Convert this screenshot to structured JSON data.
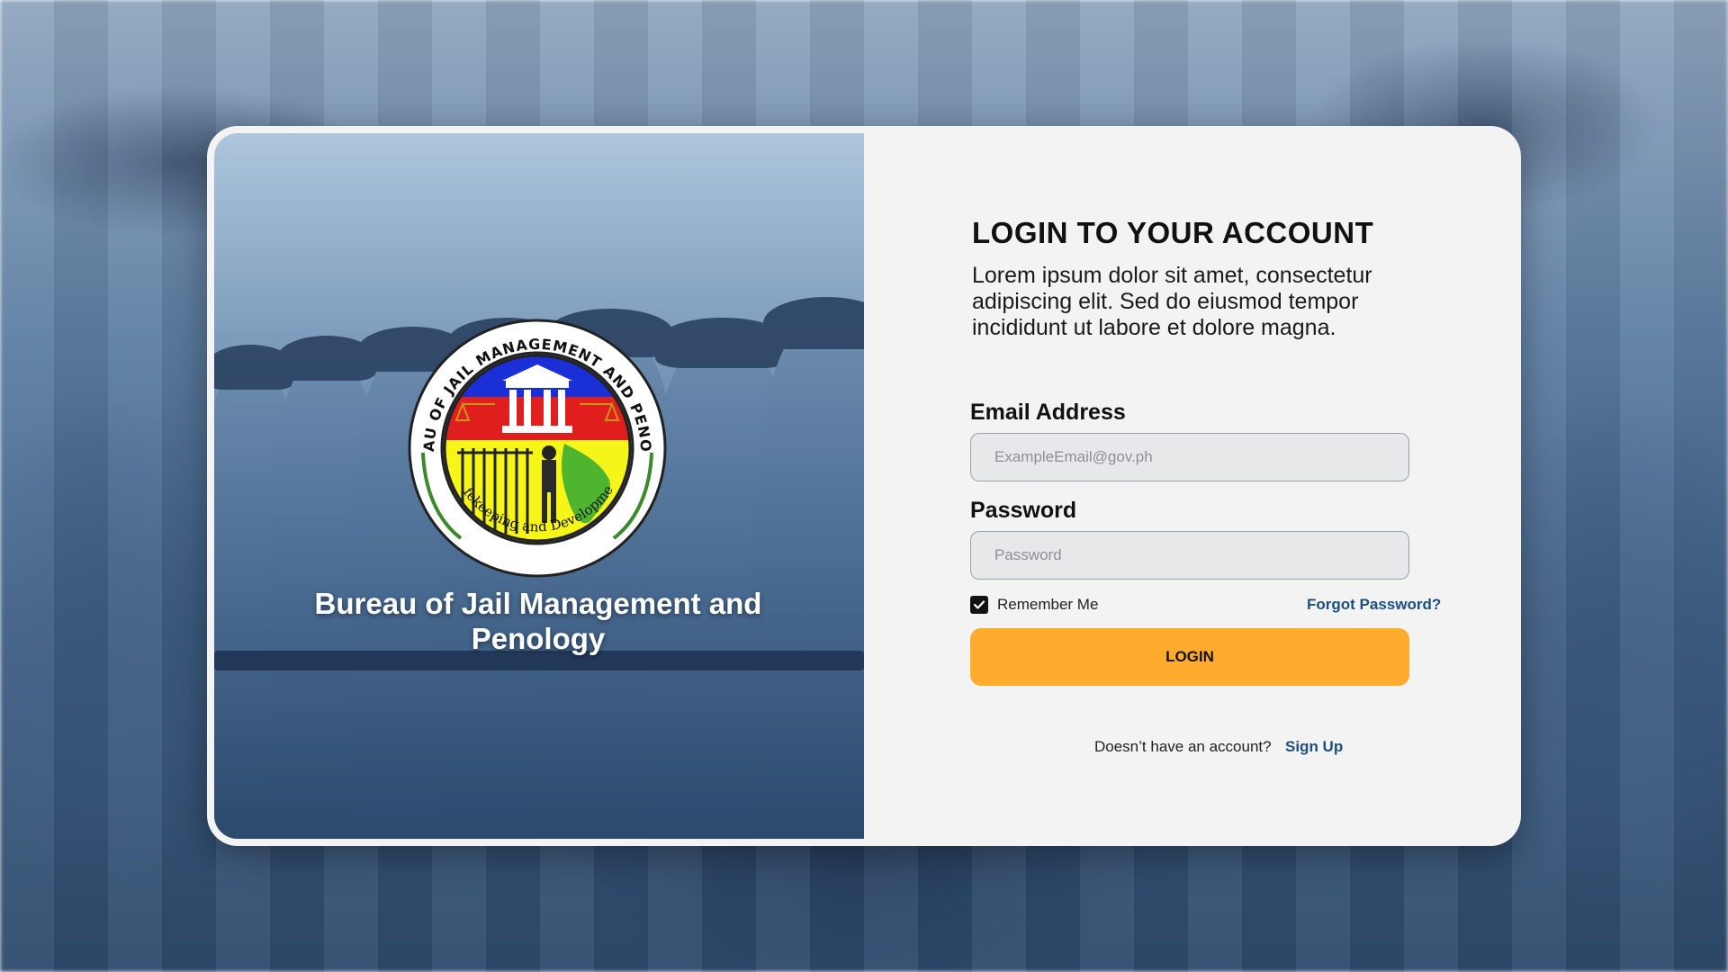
{
  "brand": {
    "agency_name": "Bureau of Jail Management and Penology",
    "seal_top_text": "BUREAU OF JAIL MANAGEMENT AND PENOLOGY",
    "seal_motto": "Safekeeping and Development"
  },
  "login": {
    "title": "LOGIN TO YOUR ACCOUNT",
    "description": "Lorem ipsum dolor sit amet, consectetur adipiscing elit. Sed do eiusmod tempor incididunt ut labore et dolore magna.",
    "email_label": "Email Address",
    "email_placeholder": "ExampleEmail@gov.ph",
    "email_value": "",
    "password_label": "Password",
    "password_placeholder": "Password",
    "password_value": "",
    "remember_label": "Remember Me",
    "remember_checked": true,
    "forgot_label": "Forgot Password?",
    "login_button": "LOGIN",
    "signup_prompt": "Doesn’t have an account?",
    "signup_link": "Sign Up"
  },
  "colors": {
    "accent": "#ffab2e",
    "link": "#1c4e80",
    "card_background": "#f3f3f3"
  },
  "icons": {
    "checkbox": "check-icon"
  }
}
